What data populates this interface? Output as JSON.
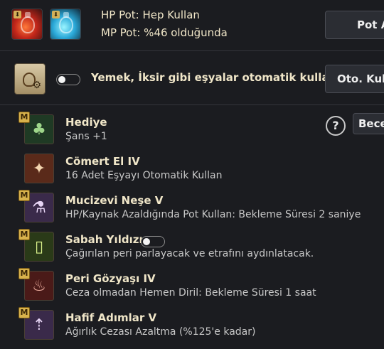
{
  "potions": {
    "hp_line": "HP Pot: Hep Kullan",
    "mp_line": "MP Pot: %46 olduğunda",
    "button_label": "Pot A"
  },
  "auto_use": {
    "text": "Yemek, İksir gibi eşyalar otomatik kullanılır.",
    "button_label": "Oto. Kull",
    "toggle_on": false
  },
  "help_label": "?",
  "skills_button_label": "Bece",
  "skills": [
    {
      "name": "Hediye",
      "desc": "Şans +1",
      "badge": "M",
      "icon": "clover-icon",
      "color": "#1f3a24"
    },
    {
      "name": "Cömert El IV",
      "desc": "16 Adet Eşyayı Otomatik Kullan",
      "badge": "",
      "icon": "fairy-icon",
      "color": "#5a2a1a"
    },
    {
      "name": "Mucizevi Neşe V",
      "desc": "HP/Kaynak Azaldığında Pot Kullan: Bekleme Süresi 2 saniye",
      "badge": "M",
      "icon": "potion-plus-icon",
      "color": "#3a2a4a"
    },
    {
      "name": "Sabah Yıldızı",
      "desc": "Çağırılan peri parlayacak ve etrafını aydınlatacak.",
      "badge": "M",
      "icon": "lantern-icon",
      "color": "#2a3a18",
      "toggle_on": false
    },
    {
      "name": "Peri Gözyaşı IV",
      "desc": "Ceza olmadan Hemen Diril: Bekleme Süresi 1 saat",
      "badge": "M",
      "icon": "tear-flask-icon",
      "color": "#4a1a18"
    },
    {
      "name": "Hafif Adımlar V",
      "desc": "Ağırlık Cezası Azaltma (%125'e kadar)",
      "badge": "M",
      "icon": "weight-arrow-icon",
      "color": "#3a2a4a"
    }
  ]
}
